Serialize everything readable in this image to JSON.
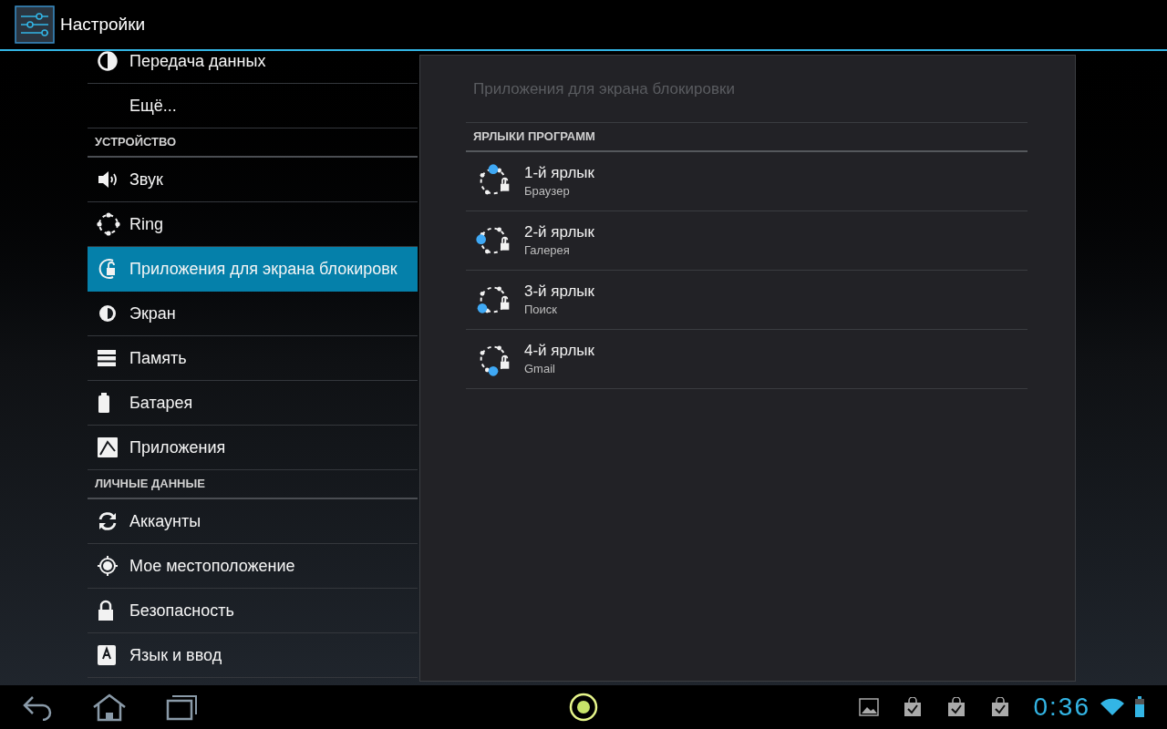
{
  "action_bar": {
    "title": "Настройки"
  },
  "sidebar": {
    "items": [
      {
        "kind": "item",
        "label": "Передача данных",
        "selected": false
      },
      {
        "kind": "item",
        "label": "Ещё...",
        "selected": false
      },
      {
        "kind": "header",
        "label": "УСТРОЙСТВО"
      },
      {
        "kind": "item",
        "label": "Звук",
        "selected": false
      },
      {
        "kind": "item",
        "label": "Ring",
        "selected": false
      },
      {
        "kind": "item",
        "label": "Приложения для экрана блокировк",
        "selected": true
      },
      {
        "kind": "item",
        "label": "Экран",
        "selected": false
      },
      {
        "kind": "item",
        "label": "Память",
        "selected": false
      },
      {
        "kind": "item",
        "label": "Батарея",
        "selected": false
      },
      {
        "kind": "item",
        "label": "Приложения",
        "selected": false
      },
      {
        "kind": "header",
        "label": "ЛИЧНЫЕ ДАННЫЕ"
      },
      {
        "kind": "item",
        "label": "Аккаунты",
        "selected": false
      },
      {
        "kind": "item",
        "label": "Мое местоположение",
        "selected": false
      },
      {
        "kind": "item",
        "label": "Безопасность",
        "selected": false
      },
      {
        "kind": "item",
        "label": "Язык и ввод",
        "selected": false
      }
    ]
  },
  "detail": {
    "title": "Приложения для экрана блокировки",
    "section": "ЯРЛЫКИ ПРОГРАММ",
    "shortcuts": [
      {
        "title": "1-й ярлык",
        "summary": "Браузер"
      },
      {
        "title": "2-й ярлык",
        "summary": "Галерея"
      },
      {
        "title": "3-й ярлык",
        "summary": "Поиск"
      },
      {
        "title": "4-й ярлык",
        "summary": "Gmail"
      }
    ]
  },
  "system_bar": {
    "time": "0:36"
  }
}
